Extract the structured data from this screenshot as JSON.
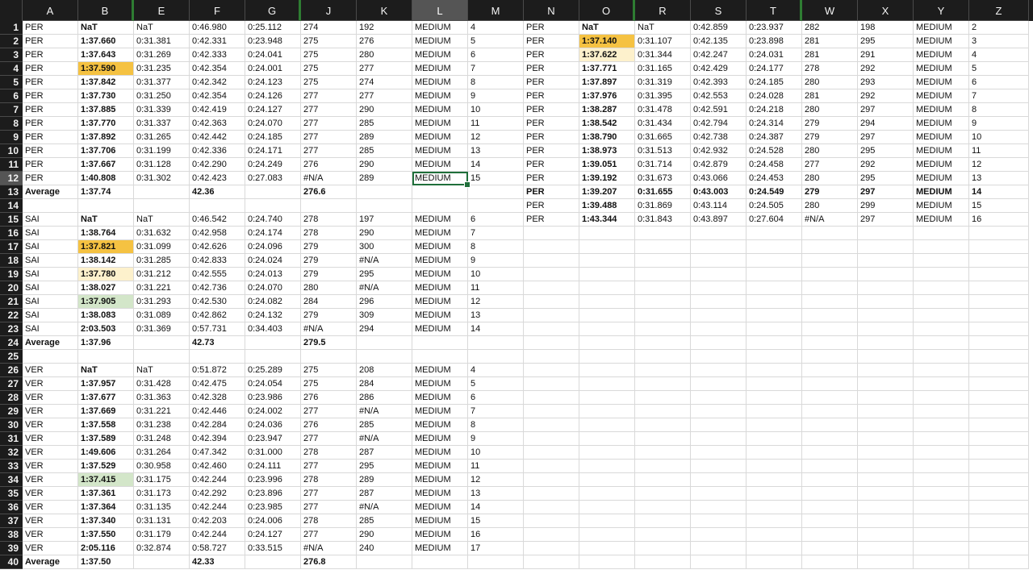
{
  "app": {
    "name": "Spreadsheet"
  },
  "columns": [
    "A",
    "B",
    "E",
    "F",
    "G",
    "J",
    "K",
    "L",
    "M",
    "N",
    "O",
    "R",
    "S",
    "T",
    "W",
    "X",
    "Y",
    "Z"
  ],
  "selected_column": "L",
  "hidden_column_markers_after": [
    "B",
    "G",
    "O",
    "T"
  ],
  "active_cell": {
    "ref": "L12",
    "value": "MEDIUM"
  },
  "row_count_visible": 40,
  "cells": {
    "1": {
      "A": "PER",
      "B": "NaT",
      "E": "NaT",
      "F": "0:46.980",
      "G": "0:25.112",
      "J": "274",
      "K": "192",
      "L": "MEDIUM",
      "M": "4",
      "N": "PER",
      "O": "NaT",
      "R": "NaT",
      "S": "0:42.859",
      "T": "0:23.937",
      "W": "282",
      "X": "198",
      "Y": "MEDIUM",
      "Z": "2"
    },
    "2": {
      "A": "PER",
      "B": "1:37.660",
      "E": "0:31.381",
      "F": "0:42.331",
      "G": "0:23.948",
      "J": "275",
      "K": "276",
      "L": "MEDIUM",
      "M": "5",
      "N": "PER",
      "O": "1:37.140",
      "R": "0:31.107",
      "S": "0:42.135",
      "T": "0:23.898",
      "W": "281",
      "X": "295",
      "Y": "MEDIUM",
      "Z": "3"
    },
    "3": {
      "A": "PER",
      "B": "1:37.643",
      "E": "0:31.269",
      "F": "0:42.333",
      "G": "0:24.041",
      "J": "275",
      "K": "280",
      "L": "MEDIUM",
      "M": "6",
      "N": "PER",
      "O": "1:37.622",
      "R": "0:31.344",
      "S": "0:42.247",
      "T": "0:24.031",
      "W": "281",
      "X": "291",
      "Y": "MEDIUM",
      "Z": "4"
    },
    "4": {
      "A": "PER",
      "B": "1:37.590",
      "E": "0:31.235",
      "F": "0:42.354",
      "G": "0:24.001",
      "J": "275",
      "K": "277",
      "L": "MEDIUM",
      "M": "7",
      "N": "PER",
      "O": "1:37.771",
      "R": "0:31.165",
      "S": "0:42.429",
      "T": "0:24.177",
      "W": "278",
      "X": "292",
      "Y": "MEDIUM",
      "Z": "5"
    },
    "5": {
      "A": "PER",
      "B": "1:37.842",
      "E": "0:31.377",
      "F": "0:42.342",
      "G": "0:24.123",
      "J": "275",
      "K": "274",
      "L": "MEDIUM",
      "M": "8",
      "N": "PER",
      "O": "1:37.897",
      "R": "0:31.319",
      "S": "0:42.393",
      "T": "0:24.185",
      "W": "280",
      "X": "293",
      "Y": "MEDIUM",
      "Z": "6"
    },
    "6": {
      "A": "PER",
      "B": "1:37.730",
      "E": "0:31.250",
      "F": "0:42.354",
      "G": "0:24.126",
      "J": "277",
      "K": "277",
      "L": "MEDIUM",
      "M": "9",
      "N": "PER",
      "O": "1:37.976",
      "R": "0:31.395",
      "S": "0:42.553",
      "T": "0:24.028",
      "W": "281",
      "X": "292",
      "Y": "MEDIUM",
      "Z": "7"
    },
    "7": {
      "A": "PER",
      "B": "1:37.885",
      "E": "0:31.339",
      "F": "0:42.419",
      "G": "0:24.127",
      "J": "277",
      "K": "290",
      "L": "MEDIUM",
      "M": "10",
      "N": "PER",
      "O": "1:38.287",
      "R": "0:31.478",
      "S": "0:42.591",
      "T": "0:24.218",
      "W": "280",
      "X": "297",
      "Y": "MEDIUM",
      "Z": "8"
    },
    "8": {
      "A": "PER",
      "B": "1:37.770",
      "E": "0:31.337",
      "F": "0:42.363",
      "G": "0:24.070",
      "J": "277",
      "K": "285",
      "L": "MEDIUM",
      "M": "11",
      "N": "PER",
      "O": "1:38.542",
      "R": "0:31.434",
      "S": "0:42.794",
      "T": "0:24.314",
      "W": "279",
      "X": "294",
      "Y": "MEDIUM",
      "Z": "9"
    },
    "9": {
      "A": "PER",
      "B": "1:37.892",
      "E": "0:31.265",
      "F": "0:42.442",
      "G": "0:24.185",
      "J": "277",
      "K": "289",
      "L": "MEDIUM",
      "M": "12",
      "N": "PER",
      "O": "1:38.790",
      "R": "0:31.665",
      "S": "0:42.738",
      "T": "0:24.387",
      "W": "279",
      "X": "297",
      "Y": "MEDIUM",
      "Z": "10"
    },
    "10": {
      "A": "PER",
      "B": "1:37.706",
      "E": "0:31.199",
      "F": "0:42.336",
      "G": "0:24.171",
      "J": "277",
      "K": "285",
      "L": "MEDIUM",
      "M": "13",
      "N": "PER",
      "O": "1:38.973",
      "R": "0:31.513",
      "S": "0:42.932",
      "T": "0:24.528",
      "W": "280",
      "X": "295",
      "Y": "MEDIUM",
      "Z": "11"
    },
    "11": {
      "A": "PER",
      "B": "1:37.667",
      "E": "0:31.128",
      "F": "0:42.290",
      "G": "0:24.249",
      "J": "276",
      "K": "290",
      "L": "MEDIUM",
      "M": "14",
      "N": "PER",
      "O": "1:39.051",
      "R": "0:31.714",
      "S": "0:42.879",
      "T": "0:24.458",
      "W": "277",
      "X": "292",
      "Y": "MEDIUM",
      "Z": "12"
    },
    "12": {
      "A": "PER",
      "B": "1:40.808",
      "E": "0:31.302",
      "F": "0:42.423",
      "G": "0:27.083",
      "J": "#N/A",
      "K": "289",
      "L": "MEDIUM",
      "M": "15",
      "N": "PER",
      "O": "1:39.192",
      "R": "0:31.673",
      "S": "0:43.066",
      "T": "0:24.453",
      "W": "280",
      "X": "295",
      "Y": "MEDIUM",
      "Z": "13"
    },
    "13": {
      "A": "Average",
      "B": "1:37.74",
      "F": "42.36",
      "J": "276.6",
      "N": "PER",
      "O": "1:39.207",
      "R": "0:31.655",
      "S": "0:43.003",
      "T": "0:24.549",
      "W": "279",
      "X": "297",
      "Y": "MEDIUM",
      "Z": "14"
    },
    "14": {
      "N": "PER",
      "O": "1:39.488",
      "R": "0:31.869",
      "S": "0:43.114",
      "T": "0:24.505",
      "W": "280",
      "X": "299",
      "Y": "MEDIUM",
      "Z": "15"
    },
    "15": {
      "A": "SAI",
      "B": "NaT",
      "E": "NaT",
      "F": "0:46.542",
      "G": "0:24.740",
      "J": "278",
      "K": "197",
      "L": "MEDIUM",
      "M": "6",
      "N": "PER",
      "O": "1:43.344",
      "R": "0:31.843",
      "S": "0:43.897",
      "T": "0:27.604",
      "W": "#N/A",
      "X": "297",
      "Y": "MEDIUM",
      "Z": "16"
    },
    "16": {
      "A": "SAI",
      "B": "1:38.764",
      "E": "0:31.632",
      "F": "0:42.958",
      "G": "0:24.174",
      "J": "278",
      "K": "290",
      "L": "MEDIUM",
      "M": "7"
    },
    "17": {
      "A": "SAI",
      "B": "1:37.821",
      "E": "0:31.099",
      "F": "0:42.626",
      "G": "0:24.096",
      "J": "279",
      "K": "300",
      "L": "MEDIUM",
      "M": "8"
    },
    "18": {
      "A": "SAI",
      "B": "1:38.142",
      "E": "0:31.285",
      "F": "0:42.833",
      "G": "0:24.024",
      "J": "279",
      "K": "#N/A",
      "L": "MEDIUM",
      "M": "9"
    },
    "19": {
      "A": "SAI",
      "B": "1:37.780",
      "E": "0:31.212",
      "F": "0:42.555",
      "G": "0:24.013",
      "J": "279",
      "K": "295",
      "L": "MEDIUM",
      "M": "10"
    },
    "20": {
      "A": "SAI",
      "B": "1:38.027",
      "E": "0:31.221",
      "F": "0:42.736",
      "G": "0:24.070",
      "J": "280",
      "K": "#N/A",
      "L": "MEDIUM",
      "M": "11"
    },
    "21": {
      "A": "SAI",
      "B": "1:37.905",
      "E": "0:31.293",
      "F": "0:42.530",
      "G": "0:24.082",
      "J": "284",
      "K": "296",
      "L": "MEDIUM",
      "M": "12"
    },
    "22": {
      "A": "SAI",
      "B": "1:38.083",
      "E": "0:31.089",
      "F": "0:42.862",
      "G": "0:24.132",
      "J": "279",
      "K": "309",
      "L": "MEDIUM",
      "M": "13"
    },
    "23": {
      "A": "SAI",
      "B": "2:03.503",
      "E": "0:31.369",
      "F": "0:57.731",
      "G": "0:34.403",
      "J": "#N/A",
      "K": "294",
      "L": "MEDIUM",
      "M": "14"
    },
    "24": {
      "A": "Average",
      "B": "1:37.96",
      "F": "42.73",
      "J": "279.5"
    },
    "25": {},
    "26": {
      "A": "VER",
      "B": "NaT",
      "E": "NaT",
      "F": "0:51.872",
      "G": "0:25.289",
      "J": "275",
      "K": "208",
      "L": "MEDIUM",
      "M": "4"
    },
    "27": {
      "A": "VER",
      "B": "1:37.957",
      "E": "0:31.428",
      "F": "0:42.475",
      "G": "0:24.054",
      "J": "275",
      "K": "284",
      "L": "MEDIUM",
      "M": "5"
    },
    "28": {
      "A": "VER",
      "B": "1:37.677",
      "E": "0:31.363",
      "F": "0:42.328",
      "G": "0:23.986",
      "J": "276",
      "K": "286",
      "L": "MEDIUM",
      "M": "6"
    },
    "29": {
      "A": "VER",
      "B": "1:37.669",
      "E": "0:31.221",
      "F": "0:42.446",
      "G": "0:24.002",
      "J": "277",
      "K": "#N/A",
      "L": "MEDIUM",
      "M": "7"
    },
    "30": {
      "A": "VER",
      "B": "1:37.558",
      "E": "0:31.238",
      "F": "0:42.284",
      "G": "0:24.036",
      "J": "276",
      "K": "285",
      "L": "MEDIUM",
      "M": "8"
    },
    "31": {
      "A": "VER",
      "B": "1:37.589",
      "E": "0:31.248",
      "F": "0:42.394",
      "G": "0:23.947",
      "J": "277",
      "K": "#N/A",
      "L": "MEDIUM",
      "M": "9"
    },
    "32": {
      "A": "VER",
      "B": "1:49.606",
      "E": "0:31.264",
      "F": "0:47.342",
      "G": "0:31.000",
      "J": "278",
      "K": "287",
      "L": "MEDIUM",
      "M": "10"
    },
    "33": {
      "A": "VER",
      "B": "1:37.529",
      "E": "0:30.958",
      "F": "0:42.460",
      "G": "0:24.111",
      "J": "277",
      "K": "295",
      "L": "MEDIUM",
      "M": "11"
    },
    "34": {
      "A": "VER",
      "B": "1:37.415",
      "E": "0:31.175",
      "F": "0:42.244",
      "G": "0:23.996",
      "J": "278",
      "K": "289",
      "L": "MEDIUM",
      "M": "12"
    },
    "35": {
      "A": "VER",
      "B": "1:37.361",
      "E": "0:31.173",
      "F": "0:42.292",
      "G": "0:23.896",
      "J": "277",
      "K": "287",
      "L": "MEDIUM",
      "M": "13"
    },
    "36": {
      "A": "VER",
      "B": "1:37.364",
      "E": "0:31.135",
      "F": "0:42.244",
      "G": "0:23.985",
      "J": "277",
      "K": "#N/A",
      "L": "MEDIUM",
      "M": "14"
    },
    "37": {
      "A": "VER",
      "B": "1:37.340",
      "E": "0:31.131",
      "F": "0:42.203",
      "G": "0:24.006",
      "J": "278",
      "K": "285",
      "L": "MEDIUM",
      "M": "15"
    },
    "38": {
      "A": "VER",
      "B": "1:37.550",
      "E": "0:31.179",
      "F": "0:42.244",
      "G": "0:24.127",
      "J": "277",
      "K": "290",
      "L": "MEDIUM",
      "M": "16"
    },
    "39": {
      "A": "VER",
      "B": "2:05.116",
      "E": "0:32.874",
      "F": "0:58.727",
      "G": "0:33.515",
      "J": "#N/A",
      "K": "240",
      "L": "MEDIUM",
      "M": "17"
    },
    "40": {
      "A": "Average",
      "B": "1:37.50",
      "F": "42.33",
      "J": "276.8"
    }
  },
  "bold_columns": [
    "B",
    "O"
  ],
  "bold_rows": [
    "13",
    "24",
    "40"
  ],
  "highlights": [
    {
      "cell": "B4",
      "color": "orange"
    },
    {
      "cell": "O2",
      "color": "orange"
    },
    {
      "cell": "O3",
      "color": "cream"
    },
    {
      "cell": "B17",
      "color": "orange"
    },
    {
      "cell": "B19",
      "color": "cream"
    },
    {
      "cell": "B21",
      "color": "green"
    },
    {
      "cell": "B34",
      "color": "green"
    }
  ],
  "colors": {
    "orange": "#f5c242",
    "cream": "#fdf1cc",
    "green": "#d3e6c9",
    "selection": "#1f6f3a",
    "header_bg": "#1c1c1c"
  }
}
